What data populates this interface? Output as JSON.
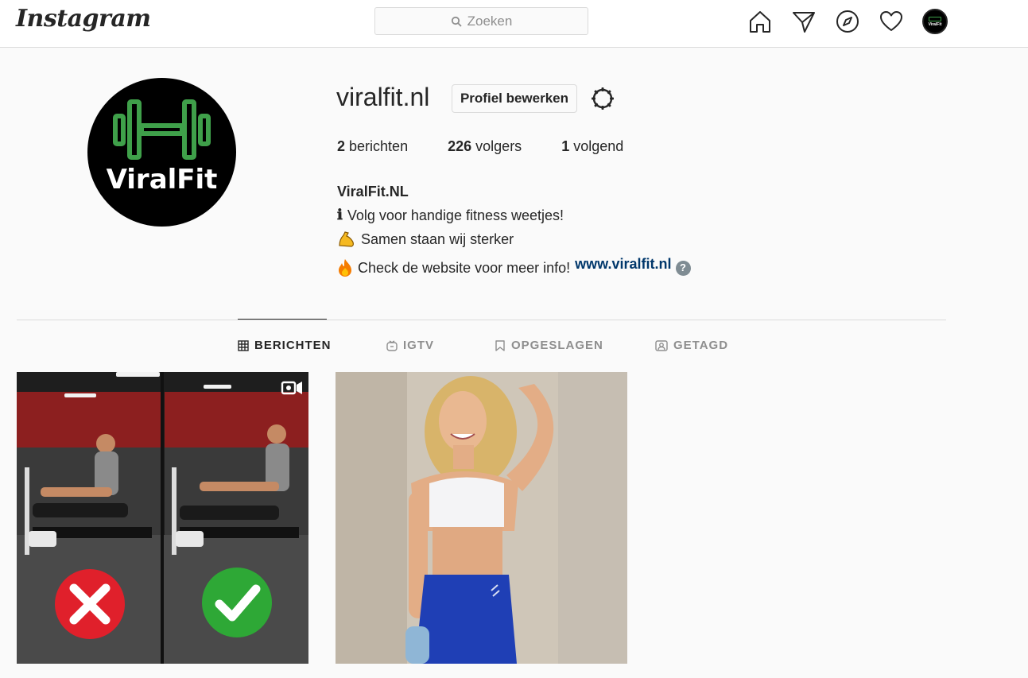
{
  "nav": {
    "logo": "Instagram",
    "search_placeholder": "Zoeken",
    "icons": [
      "home-icon",
      "direct-icon",
      "explore-icon",
      "activity-icon",
      "avatar"
    ]
  },
  "profile": {
    "username": "viralfit.nl",
    "edit_button": "Profiel bewerken",
    "avatar_brand": "ViralFit",
    "stats": [
      {
        "count": "2",
        "label": "berichten"
      },
      {
        "count": "226",
        "label": "volgers"
      },
      {
        "count": "1",
        "label": "volgend"
      }
    ],
    "bio": {
      "name": "ViralFit.NL",
      "line1": "Volg voor handige fitness weetjes!",
      "line1_emoji": "ℹ",
      "line2": "Samen staan wij sterker",
      "line2_emoji": "💪",
      "line3": "Check de website voor meer info!",
      "line3_emoji": "🔥",
      "link": "www.viralfit.nl",
      "help": "?"
    }
  },
  "tabs": [
    {
      "label": "BERICHTEN",
      "icon": "grid-icon",
      "active": true
    },
    {
      "label": "IGTV",
      "icon": "igtv-icon",
      "active": false
    },
    {
      "label": "OPGESLAGEN",
      "icon": "bookmark-icon",
      "active": false
    },
    {
      "label": "GETAGD",
      "icon": "tagged-icon",
      "active": false
    }
  ],
  "colors": {
    "brand_green": "#3fa04a",
    "link": "#00376b",
    "wrong": "#e0202b",
    "right": "#2ea836",
    "leggings": "#1f3fb5"
  }
}
